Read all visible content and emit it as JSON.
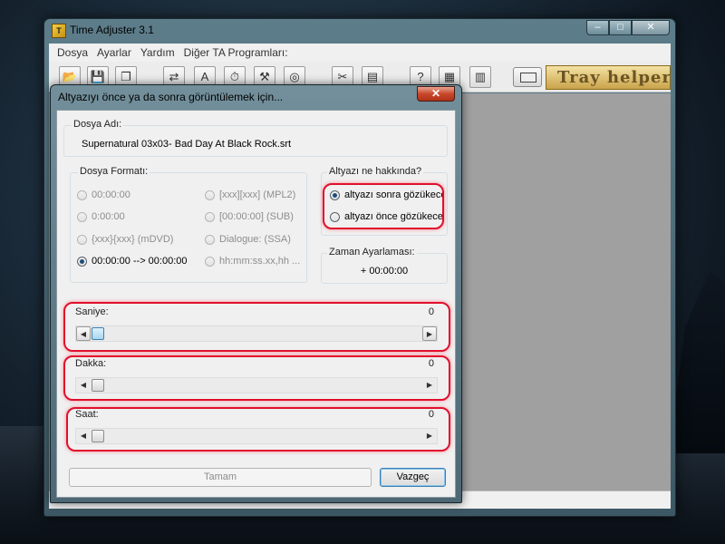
{
  "main_window": {
    "title": "Time Adjuster 3.1",
    "caption_buttons": {
      "minimize": "–",
      "maximize": "□",
      "close": "✕"
    },
    "menu": [
      "Dosya",
      "Ayarlar",
      "Yardım",
      "Diğer TA Programları:"
    ],
    "toolbar": {
      "buttons": [
        {
          "icon": "open-folder-icon",
          "glyph": "📂"
        },
        {
          "icon": "save-icon",
          "glyph": "💾"
        },
        {
          "icon": "copy-icon",
          "glyph": "❐"
        },
        {
          "icon": "swap-arrows-icon",
          "glyph": "⇄"
        },
        {
          "icon": "ab-sort-icon",
          "glyph": "A"
        },
        {
          "icon": "stopwatch-icon",
          "glyph": "⏱"
        },
        {
          "icon": "hammer-icon",
          "glyph": "⚒"
        },
        {
          "icon": "my-file-icon",
          "glyph": "◎"
        },
        {
          "icon": "cut-file-icon",
          "glyph": "✂"
        },
        {
          "icon": "merge-files-icon",
          "glyph": "▤"
        },
        {
          "icon": "help-file-icon",
          "glyph": "?"
        },
        {
          "icon": "film-help-icon",
          "glyph": "▦"
        },
        {
          "icon": "chart-file-icon",
          "glyph": "▥"
        }
      ],
      "tray_helper_text": "Tray helper"
    }
  },
  "dialog": {
    "title": "Altyazıyı önce ya da sonra görüntülemek için...",
    "close_glyph": "✕",
    "file_name_label": "Dosya Adı:",
    "file_name": "Supernatural 03x03- Bad Day At Black Rock.srt",
    "file_format": {
      "label": "Dosya Formatı:",
      "options": [
        {
          "text": "00:00:00",
          "checked": false,
          "enabled": false
        },
        {
          "text": "0:00:00",
          "checked": false,
          "enabled": false
        },
        {
          "text": "{xxx}{xxx}     (mDVD)",
          "checked": false,
          "enabled": false
        },
        {
          "text": "00:00:00 --> 00:00:00",
          "checked": true,
          "enabled": true
        },
        {
          "text": "[xxx][xxx]     (MPL2)",
          "checked": false,
          "enabled": false
        },
        {
          "text": "[00:00:00]  (SUB)",
          "checked": false,
          "enabled": false
        },
        {
          "text": "Dialogue:   (SSA)",
          "checked": false,
          "enabled": false
        },
        {
          "text": "hh:mm:ss.xx,hh ...",
          "checked": false,
          "enabled": false
        }
      ]
    },
    "about": {
      "label": "Altyazı ne hakkında?",
      "options": [
        {
          "text": "altyazı sonra gözükecek",
          "checked": true
        },
        {
          "text": "altyazı önce gözükecek",
          "checked": false
        }
      ]
    },
    "adjustment": {
      "label": "Zaman Ayarlaması:",
      "value": "+ 00:00:00"
    },
    "sliders": [
      {
        "label": "Saniye:",
        "value": "0",
        "level": 0,
        "active": true
      },
      {
        "label": "Dakka:",
        "value": "0",
        "level": 0,
        "active": false
      },
      {
        "label": "Saat:",
        "value": "0",
        "level": 0,
        "active": false
      }
    ],
    "ok_label": "Tamam",
    "cancel_label": "Vazgeç"
  },
  "colors": {
    "highlight": "#e0102c",
    "client_gray": "#a0a0a0",
    "dialog_frame": "#728f9b"
  }
}
